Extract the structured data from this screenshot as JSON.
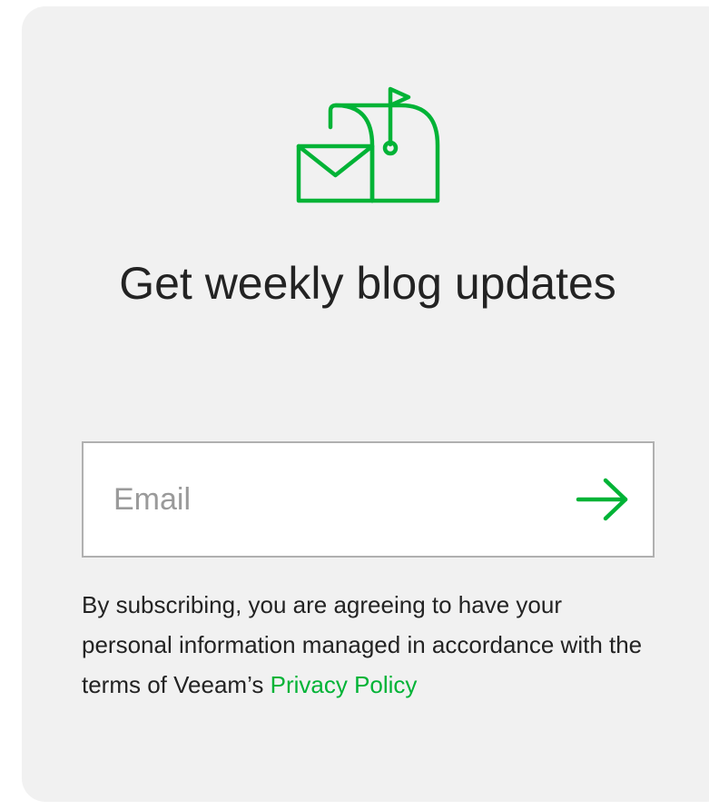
{
  "icon": "mailbox-icon",
  "accent_color": "#00b336",
  "heading": "Get weekly blog updates",
  "form": {
    "email_placeholder": "Email",
    "email_value": "",
    "submit_icon": "arrow-right-icon"
  },
  "consent": {
    "text": "By subscribing, you are agreeing to have your personal information managed in accordance with the terms of Veeam’s ",
    "link_text": "Privacy Policy"
  }
}
